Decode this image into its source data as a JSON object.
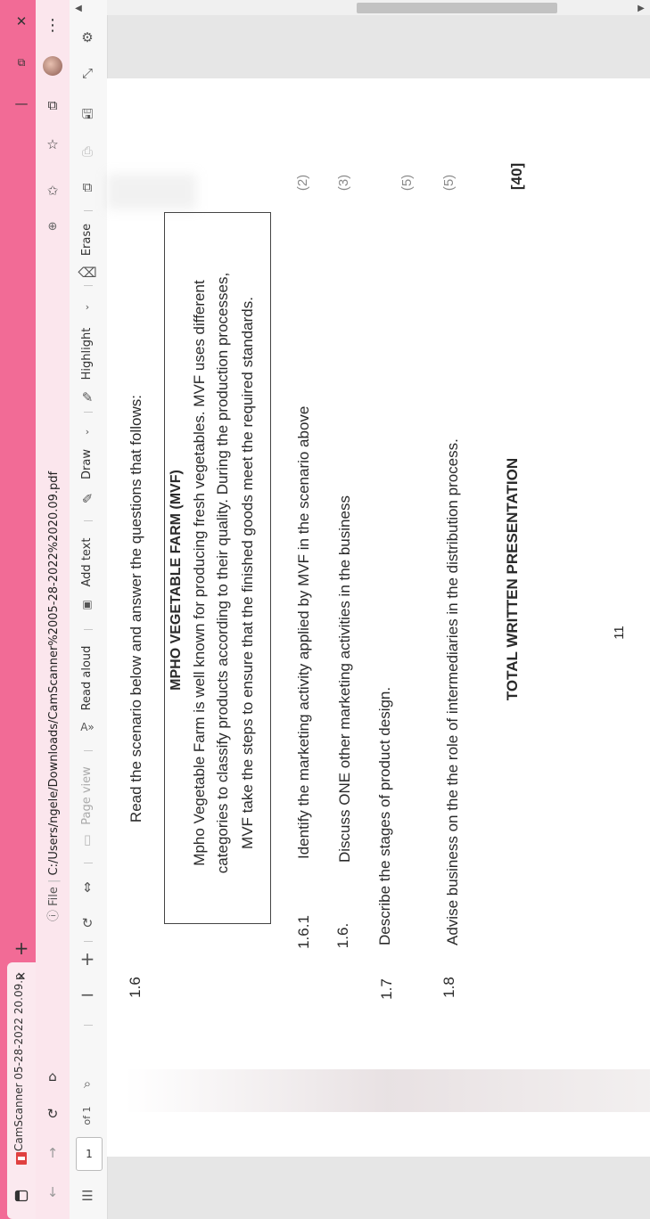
{
  "browser": {
    "tab_title": "CamScanner 05-28-2022 20.09.p",
    "url_label": "File",
    "url": "C:/Users/ngele/Downloads/CamScanner%2005-28-2022%2020.09.pdf",
    "accent_color": "#f26b96"
  },
  "pdf_toolbar": {
    "page_number": "1",
    "page_total": "of 1",
    "zoom_out": "−",
    "zoom_in": "+",
    "page_view": "Page view",
    "read_aloud": "Read aloud",
    "add_text": "Add text",
    "draw": "Draw",
    "highlight": "Highlight",
    "erase": "Erase"
  },
  "document": {
    "q16_num": "1.6",
    "q16_text": "Read the scenario below and answer the questions that follows:",
    "box_title": "MPHO VEGETABLE FARM (MVF)",
    "box_line1": "Mpho Vegetable Farm is well known for producing fresh vegetables.  MVF uses different",
    "box_line2": "categories to classify  products according to their quality. During the production  processes,",
    "box_line3": "MVF take the steps to ensure that the finished goods meet the required standards.",
    "q161_num": "1.6.1",
    "q161_text": "Identify the marketing activity applied by  MVF in the scenario above",
    "q161_marks": "(2)",
    "q162_num": "1.6.",
    "q162_text": "Discuss ONE  other marketing activities in the business",
    "q162_marks": "(3)",
    "q17_num": "1.7",
    "q17_text": "Describe the stages of product design.",
    "q17_marks": "(5)",
    "q18_num": "1.8",
    "q18_text": "Advise business on the  the role of intermediaries in the distribution process.",
    "q18_marks": "(5)",
    "total_label": "TOTAL WRITTEN PRESENTATION",
    "total_marks": "[40]",
    "page_num": "11"
  }
}
